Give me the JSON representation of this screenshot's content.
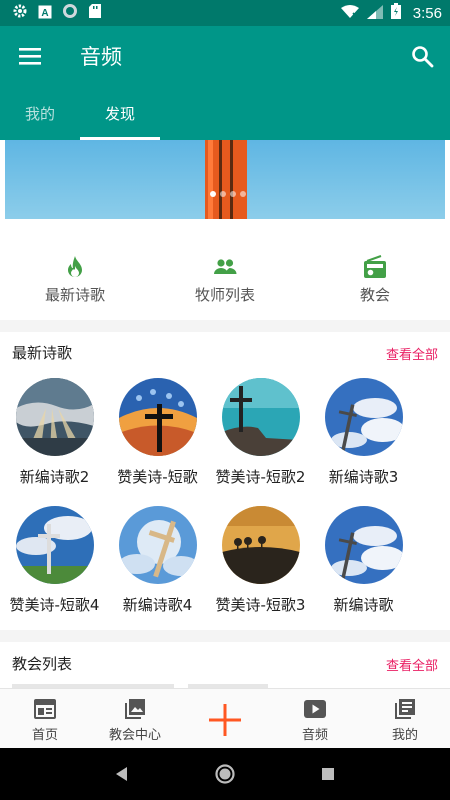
{
  "status_bar": {
    "time": "3:56"
  },
  "app_bar": {
    "title": "音频",
    "tabs": [
      {
        "label": "我的",
        "active": false
      },
      {
        "label": "发现",
        "active": true
      }
    ]
  },
  "banner": {
    "page_count": 4,
    "active_page": 1
  },
  "quick_nav": [
    {
      "label": "最新诗歌",
      "icon": "flame-icon"
    },
    {
      "label": "牧师列表",
      "icon": "people-icon"
    },
    {
      "label": "教会",
      "icon": "radio-icon"
    }
  ],
  "sections": {
    "latest": {
      "title": "最新诗歌",
      "view_all": "查看全部"
    },
    "churches": {
      "title": "教会列表",
      "view_all": "查看全部"
    }
  },
  "songs": [
    {
      "label": "新编诗歌2",
      "thumb": "sun-rays-clouds"
    },
    {
      "label": "赞美诗-短歌",
      "thumb": "cross-sunset-sky"
    },
    {
      "label": "赞美诗-短歌2",
      "thumb": "cross-sea-rock"
    },
    {
      "label": "新编诗歌3",
      "thumb": "cross-blue-sky"
    },
    {
      "label": "赞美诗-短歌4",
      "thumb": "cross-cloudy-field"
    },
    {
      "label": "新编诗歌4",
      "thumb": "cross-light-beams"
    },
    {
      "label": "赞美诗-短歌3",
      "thumb": "trees-golden-hill"
    },
    {
      "label": "新编诗歌",
      "thumb": "cross-blue-sky"
    }
  ],
  "bottom_nav": [
    {
      "label": "首页",
      "icon": "home-icon"
    },
    {
      "label": "教会中心",
      "icon": "image-icon"
    },
    {
      "label": "",
      "icon": "plus-icon"
    },
    {
      "label": "音频",
      "icon": "play-icon"
    },
    {
      "label": "我的",
      "icon": "library-icon"
    }
  ],
  "colors": {
    "primary": "#009688",
    "primary_dark": "#00796b",
    "accent_pink": "#e91e63",
    "icon_green": "#43a047",
    "plus_orange": "#ff5722"
  }
}
